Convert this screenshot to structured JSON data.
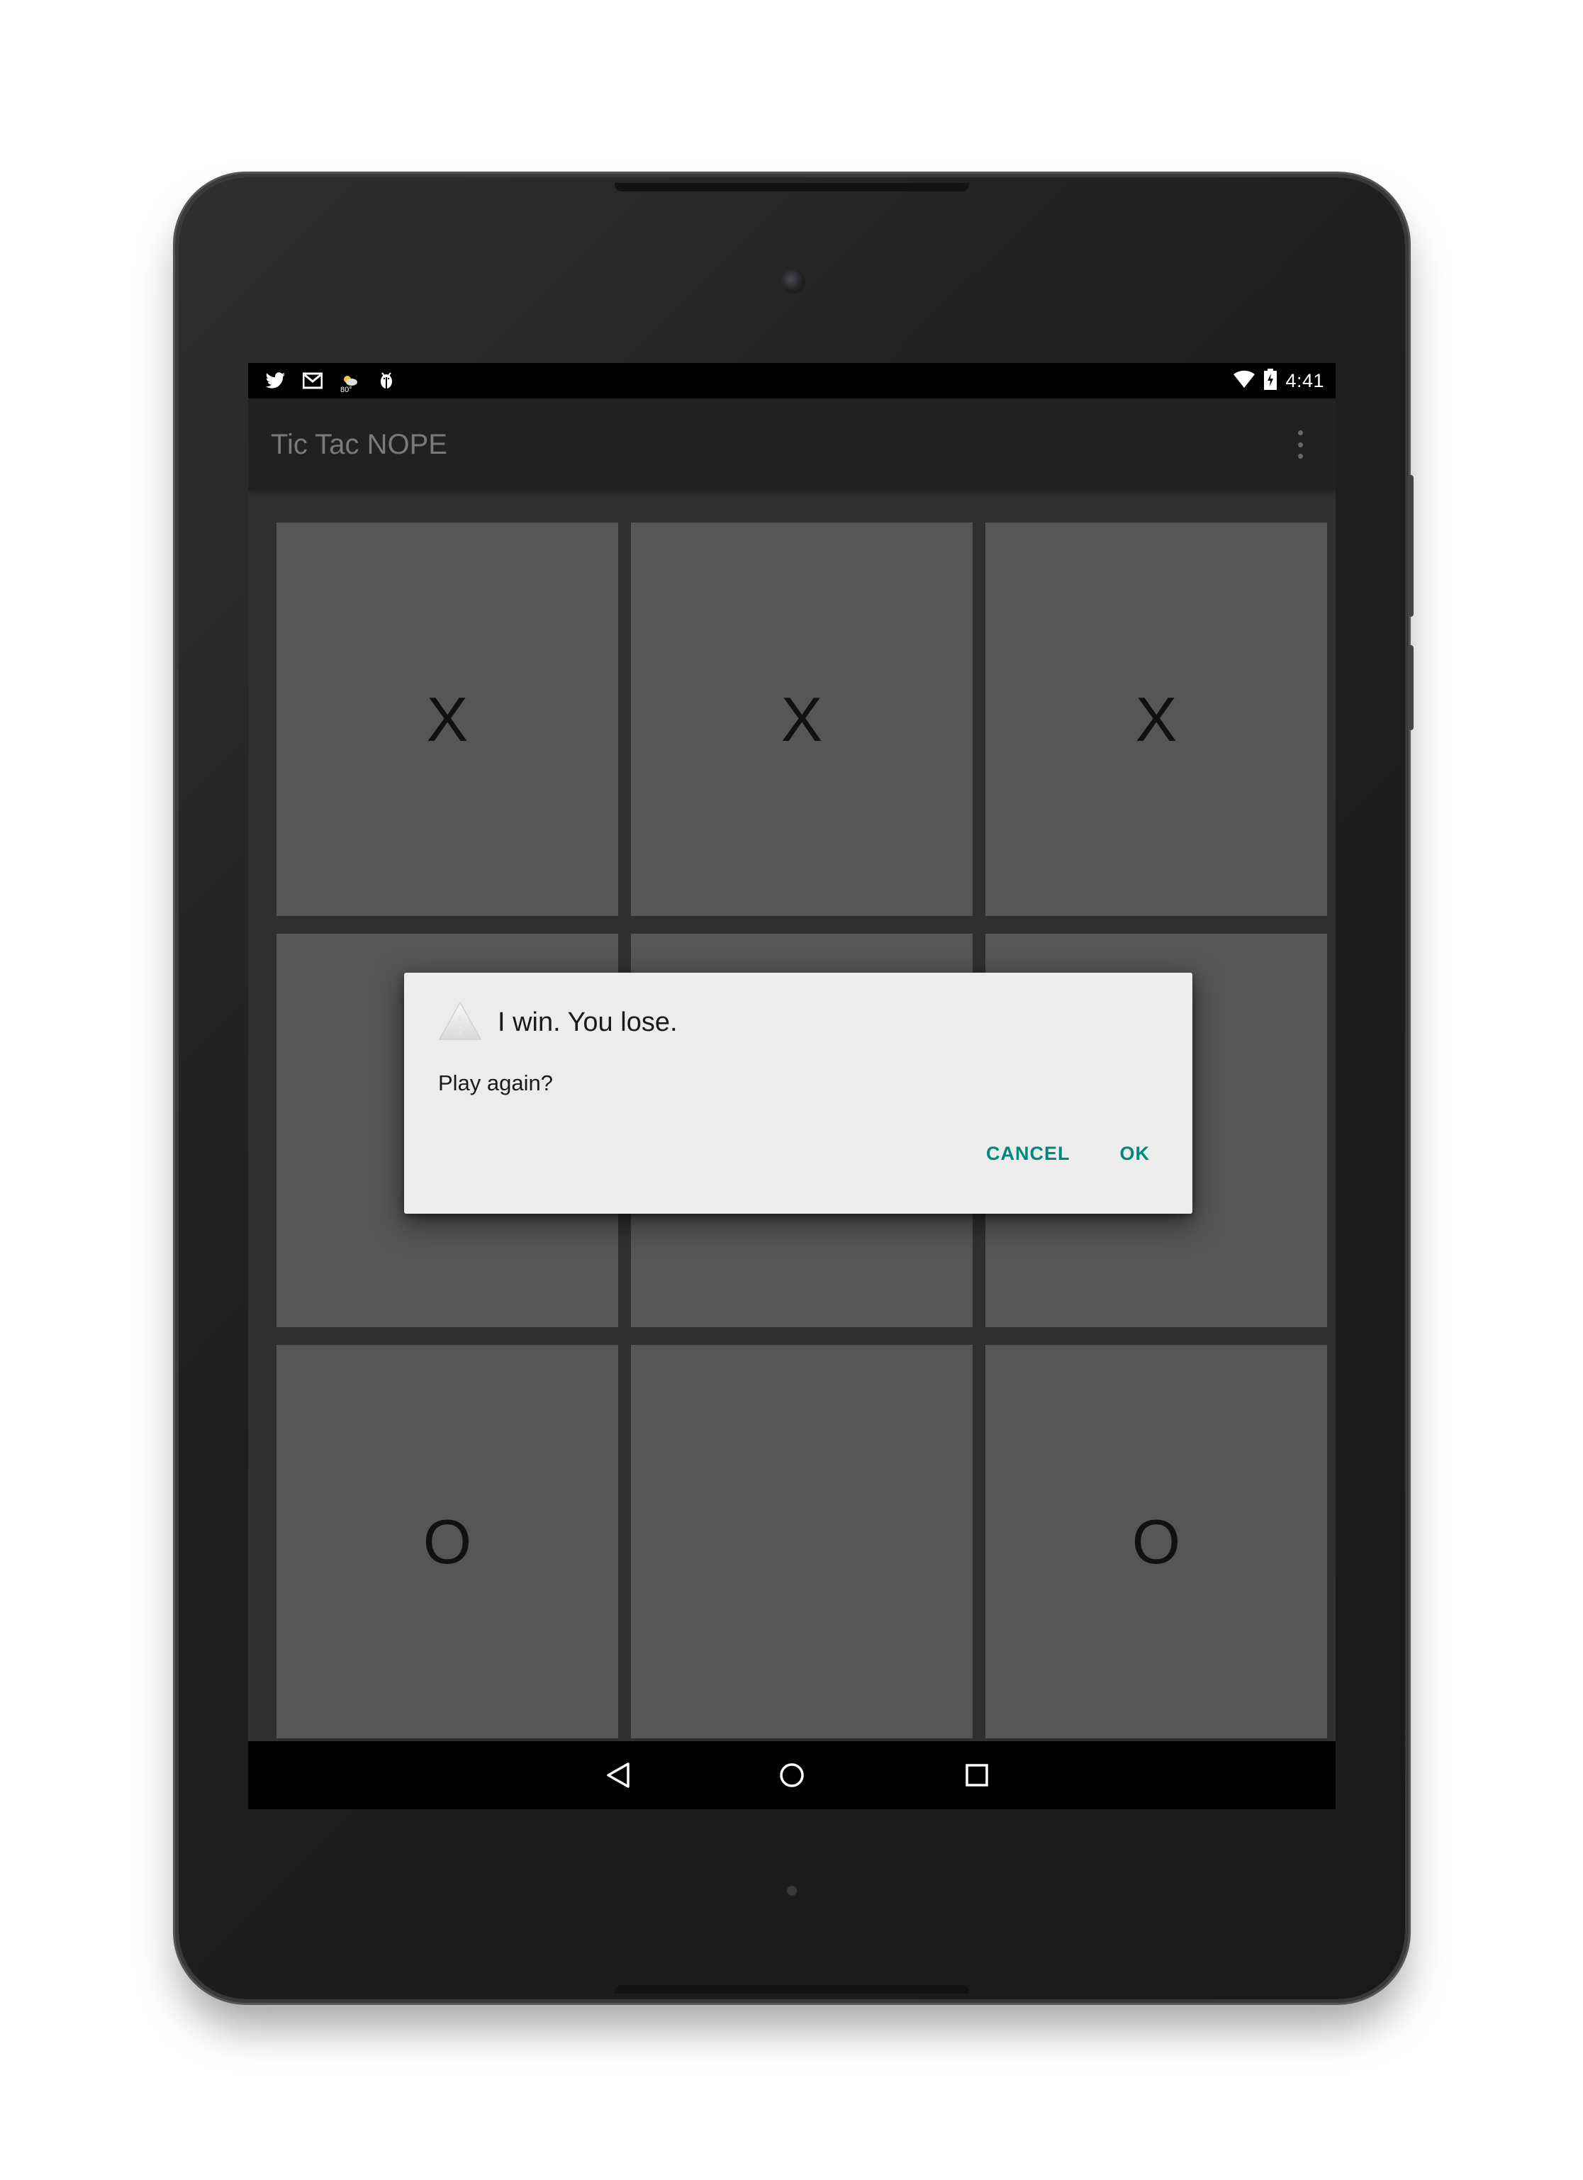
{
  "status_bar": {
    "time": "4:41",
    "weather_temp": "80°",
    "left_icons": [
      "twitter-icon",
      "gmail-icon",
      "weather-icon",
      "android-debug-icon"
    ],
    "right_icons": [
      "wifi-icon",
      "battery-charging-icon"
    ]
  },
  "action_bar": {
    "title": "Tic Tac NOPE",
    "overflow_icon": "overflow-menu-icon"
  },
  "board": {
    "cells": [
      "X",
      "X",
      "X",
      "",
      "",
      "",
      "O",
      "",
      "O"
    ]
  },
  "dialog": {
    "icon": "warning-icon",
    "title": "I win. You lose.",
    "message": "Play again?",
    "cancel_label": "CANCEL",
    "ok_label": "OK"
  },
  "nav_bar": {
    "icons": [
      "back-icon",
      "home-icon",
      "recents-icon"
    ]
  },
  "colors": {
    "accent": "#00897b",
    "cell": "#565656",
    "dialog_bg": "#ececec",
    "action_bar": "#212121"
  }
}
